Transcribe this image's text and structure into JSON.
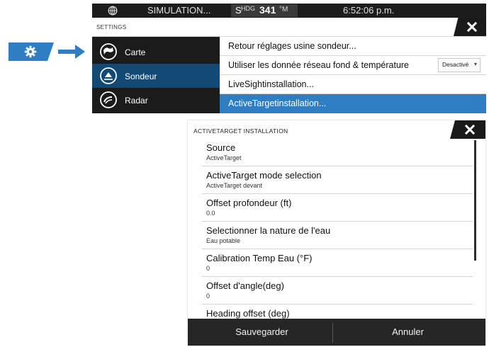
{
  "statusbar": {
    "simulation": "SIMULATION...",
    "heading_prefix": "S",
    "heading_label": "HDG",
    "heading_value": "341",
    "heading_unit": "°M",
    "time": "6:52:06 p.m."
  },
  "settings": {
    "title": "SETTINGS",
    "sidebar": [
      {
        "label": "Carte",
        "icon": "chart-icon"
      },
      {
        "label": "Sondeur",
        "icon": "sonar-icon"
      },
      {
        "label": "Radar",
        "icon": "radar-icon"
      }
    ],
    "options": [
      {
        "label": "Retour réglages usine sondeur..."
      },
      {
        "label": "Utiliser les donnée réseau fond & température",
        "value": "Desactivé"
      },
      {
        "label": "LiveSightinstallation..."
      },
      {
        "label": "ActiveTargetinstallation..."
      }
    ]
  },
  "dialog": {
    "title": "ACTIVETARGET INSTALLATION",
    "rows": [
      {
        "label": "Source",
        "value": "ActiveTarget"
      },
      {
        "label": "ActiveTarget mode selection",
        "value": "ActiveTarget devant"
      },
      {
        "label": "Offset profondeur (ft)",
        "value": "0.0"
      },
      {
        "label": "Selectionner la nature de l'eau",
        "value": "Eau potable"
      },
      {
        "label": "Calibration Temp Eau (°F)",
        "value": "0"
      },
      {
        "label": "Offset d'angle(deg)",
        "value": "0"
      },
      {
        "label": "Heading offset (deg)",
        "value": ""
      }
    ],
    "save_label": "Sauvegarder",
    "cancel_label": "Annuler"
  },
  "colors": {
    "accent_blue": "#2f7ec4",
    "selected_dark_blue": "#134a75",
    "dark_panel": "#1b1b1b"
  }
}
